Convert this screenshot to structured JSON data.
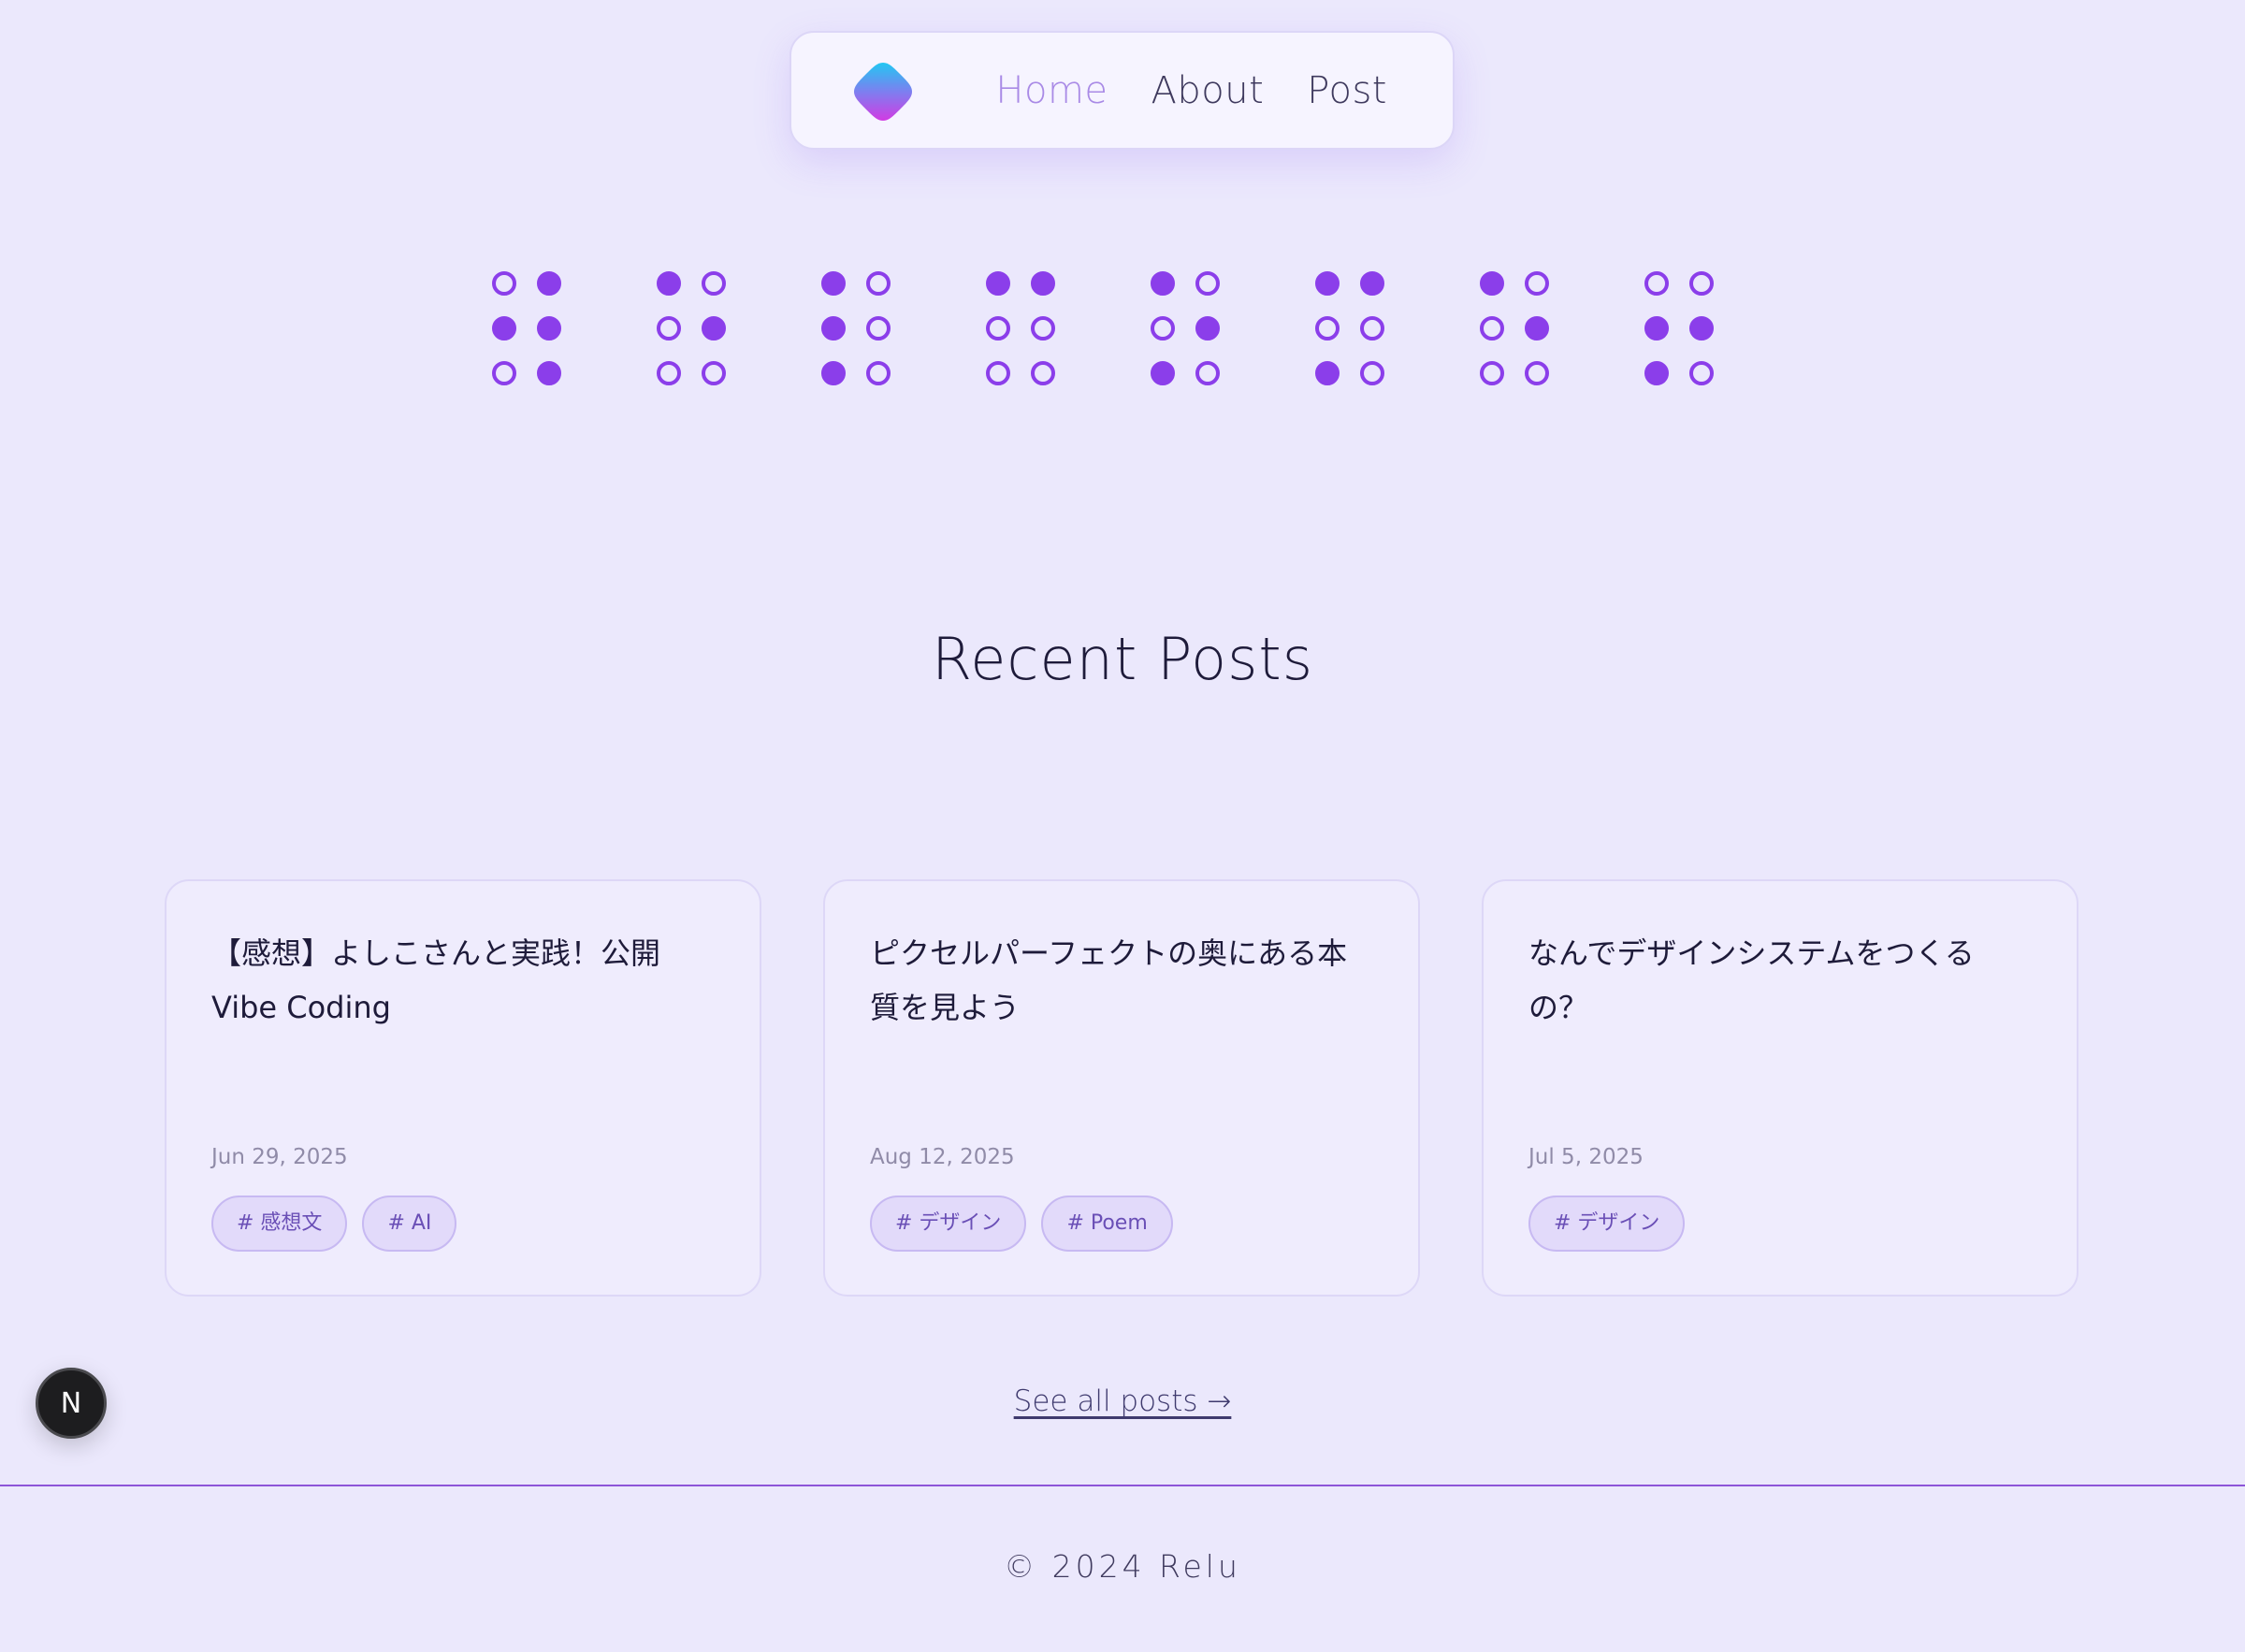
{
  "nav": {
    "logo_icon": "gradient-rounded-diamond",
    "links": [
      {
        "label": "Home",
        "active": true
      },
      {
        "label": "About",
        "active": false
      },
      {
        "label": "Post",
        "active": false
      }
    ]
  },
  "braille": {
    "dot_color": "#8b3eea",
    "cells": [
      [
        [
          false,
          true
        ],
        [
          true,
          true
        ],
        [
          false,
          true
        ]
      ],
      [
        [
          true,
          false
        ],
        [
          false,
          true
        ],
        [
          false,
          false
        ]
      ],
      [
        [
          true,
          false
        ],
        [
          true,
          false
        ],
        [
          true,
          false
        ]
      ],
      [
        [
          true,
          true
        ],
        [
          false,
          false
        ],
        [
          false,
          false
        ]
      ],
      [
        [
          true,
          false
        ],
        [
          false,
          true
        ],
        [
          true,
          false
        ]
      ],
      [
        [
          true,
          true
        ],
        [
          false,
          false
        ],
        [
          true,
          false
        ]
      ],
      [
        [
          true,
          false
        ],
        [
          false,
          true
        ],
        [
          false,
          false
        ]
      ],
      [
        [
          false,
          false
        ],
        [
          true,
          true
        ],
        [
          true,
          false
        ]
      ]
    ]
  },
  "recent": {
    "title": "Recent Posts",
    "posts": [
      {
        "title": "【感想】よしこさんと実践！公開Vibe Coding",
        "date": "Jun 29, 2025",
        "tags": [
          "# 感想文",
          "# AI"
        ]
      },
      {
        "title": "ピクセルパーフェクトの奥にある本質を見よう",
        "date": "Aug 12, 2025",
        "tags": [
          "# デザイン",
          "# Poem"
        ]
      },
      {
        "title": "なんでデザインシステムをつくるの？",
        "date": "Jul 5, 2025",
        "tags": [
          "# デザイン"
        ]
      }
    ],
    "see_all": "See all posts →"
  },
  "footer": {
    "copyright": "© 2024 Relu"
  },
  "dev_badge": {
    "label": "N",
    "icon": "nextjs-badge-icon"
  },
  "colors": {
    "accent": "#8b3eea",
    "active_link": "#a98ae6",
    "background": "#ebe8fc"
  }
}
